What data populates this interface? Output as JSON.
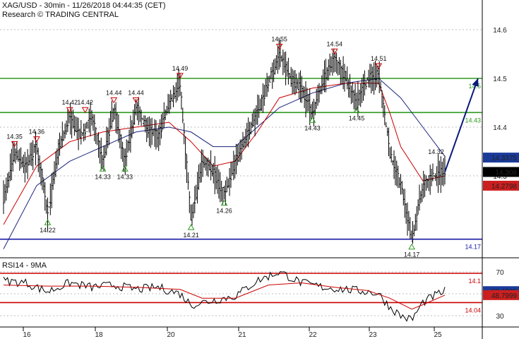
{
  "header": {
    "title": "XAG/USD - 30min - 11/26/2018 04:44:35 (CET)",
    "subtitle": "Research © TRADING CENTRAL"
  },
  "rsi_panel": {
    "label": "RSI14 - 9MA"
  },
  "colors": {
    "price": "#000000",
    "ma_fast": "#cc0000",
    "ma_slow": "#1a237e",
    "resistance": "#2e9a1e",
    "pivot": "#1a1aa6",
    "support": "#cc0000",
    "arrow": "#0a1a7a",
    "badge_blue": "#1a3a9a",
    "badge_red": "#cc1f1f",
    "badge_black": "#000000",
    "grid": "#bdbdbd"
  },
  "chart_data": [
    {
      "type": "line",
      "name": "price",
      "y_ticks": [
        14.3,
        14.4,
        14.5,
        14.6
      ],
      "y_tick_labels": [
        "14.3",
        "14.4",
        "14.5",
        "14.6"
      ],
      "x_tick_labels": [
        "16",
        "18",
        "20",
        "21",
        "22",
        "23",
        "25"
      ],
      "close_path": [
        [
          0,
          14.25
        ],
        [
          1,
          14.35
        ],
        [
          2,
          14.32
        ],
        [
          3,
          14.36
        ],
        [
          4,
          14.22
        ],
        [
          5,
          14.36
        ],
        [
          6,
          14.42
        ],
        [
          7,
          14.38
        ],
        [
          8,
          14.42
        ],
        [
          9,
          14.33
        ],
        [
          10,
          14.44
        ],
        [
          11,
          14.33
        ],
        [
          12,
          14.44
        ],
        [
          13,
          14.4
        ],
        [
          14,
          14.38
        ],
        [
          15,
          14.45
        ],
        [
          16,
          14.49
        ],
        [
          17,
          14.21
        ],
        [
          18,
          14.33
        ],
        [
          19,
          14.31
        ],
        [
          20,
          14.26
        ],
        [
          21,
          14.33
        ],
        [
          22,
          14.38
        ],
        [
          23,
          14.43
        ],
        [
          24,
          14.49
        ],
        [
          25,
          14.55
        ],
        [
          26,
          14.5
        ],
        [
          27,
          14.48
        ],
        [
          28,
          14.43
        ],
        [
          29,
          14.5
        ],
        [
          30,
          14.54
        ],
        [
          31,
          14.5
        ],
        [
          32,
          14.45
        ],
        [
          33,
          14.5
        ],
        [
          34,
          14.51
        ],
        [
          35,
          14.35
        ],
        [
          36,
          14.28
        ],
        [
          37,
          14.17
        ],
        [
          38,
          14.28
        ],
        [
          39,
          14.3
        ],
        [
          40,
          14.308
        ]
      ],
      "moving_average_fast": [
        [
          0,
          14.2
        ],
        [
          3,
          14.32
        ],
        [
          6,
          14.37
        ],
        [
          9,
          14.39
        ],
        [
          12,
          14.4
        ],
        [
          15,
          14.41
        ],
        [
          17,
          14.37
        ],
        [
          19,
          14.32
        ],
        [
          21,
          14.33
        ],
        [
          23,
          14.39
        ],
        [
          25,
          14.46
        ],
        [
          28,
          14.48
        ],
        [
          31,
          14.49
        ],
        [
          34,
          14.49
        ],
        [
          35,
          14.43
        ],
        [
          36,
          14.36
        ],
        [
          38,
          14.29
        ],
        [
          40,
          14.3
        ]
      ],
      "moving_average_slow": [
        [
          0,
          14.15
        ],
        [
          3,
          14.28
        ],
        [
          6,
          14.33
        ],
        [
          9,
          14.36
        ],
        [
          12,
          14.39
        ],
        [
          15,
          14.4
        ],
        [
          17,
          14.39
        ],
        [
          19,
          14.36
        ],
        [
          21,
          14.36
        ],
        [
          23,
          14.4
        ],
        [
          25,
          14.44
        ],
        [
          28,
          14.47
        ],
        [
          31,
          14.49
        ],
        [
          34,
          14.5
        ],
        [
          36,
          14.46
        ],
        [
          38,
          14.4
        ],
        [
          40,
          14.34
        ]
      ],
      "levels": [
        {
          "value": 14.5,
          "label": "14.5",
          "kind": "resistance"
        },
        {
          "value": 14.43,
          "label": "14.43",
          "kind": "resistance"
        },
        {
          "value": 14.17,
          "label": "14.17",
          "kind": "pivot"
        },
        {
          "value": 14.1,
          "label": "14.1",
          "kind": "support"
        },
        {
          "value": 14.04,
          "label": "14.04",
          "kind": "support"
        }
      ],
      "badges": [
        {
          "value": 14.3375,
          "label": "14.3375",
          "color": "blue"
        },
        {
          "value": 14.308,
          "label": "14.308",
          "color": "black"
        },
        {
          "value": 14.2798,
          "label": "14.2798",
          "color": "red"
        }
      ],
      "forecast_arrow": {
        "from": [
          40,
          14.308
        ],
        "to": [
          43,
          14.5
        ]
      },
      "annotations": [
        {
          "label": "14.35",
          "x": 1,
          "value": 14.35,
          "dir": "high"
        },
        {
          "label": "14.36",
          "x": 3,
          "value": 14.36,
          "dir": "high"
        },
        {
          "label": "14.22",
          "x": 4,
          "value": 14.22,
          "dir": "low"
        },
        {
          "label": "14.42",
          "x": 6,
          "value": 14.42,
          "dir": "high"
        },
        {
          "label": "14.42",
          "x": 7.4,
          "value": 14.42,
          "dir": "high"
        },
        {
          "label": "14.33",
          "x": 9,
          "value": 14.33,
          "dir": "low"
        },
        {
          "label": "14.44",
          "x": 10,
          "value": 14.44,
          "dir": "high"
        },
        {
          "label": "14.33",
          "x": 11,
          "value": 14.33,
          "dir": "low"
        },
        {
          "label": "14.44",
          "x": 12,
          "value": 14.44,
          "dir": "high"
        },
        {
          "label": "14.49",
          "x": 16,
          "value": 14.49,
          "dir": "high"
        },
        {
          "label": "14.21",
          "x": 17,
          "value": 14.21,
          "dir": "low"
        },
        {
          "label": "14.26",
          "x": 20,
          "value": 14.26,
          "dir": "low"
        },
        {
          "label": "14.55",
          "x": 25,
          "value": 14.55,
          "dir": "high"
        },
        {
          "label": "14.43",
          "x": 28,
          "value": 14.43,
          "dir": "low"
        },
        {
          "label": "14.54",
          "x": 30,
          "value": 14.54,
          "dir": "high"
        },
        {
          "label": "14.45",
          "x": 32,
          "value": 14.45,
          "dir": "low"
        },
        {
          "label": "14.51",
          "x": 34,
          "value": 14.51,
          "dir": "high"
        },
        {
          "label": "14.17",
          "x": 37,
          "value": 14.17,
          "dir": "low"
        },
        {
          "label": "14.32",
          "x": 39.2,
          "value": 14.345,
          "dir": "text"
        }
      ]
    },
    {
      "type": "line",
      "name": "RSI14 - 9MA",
      "y_ticks": [
        30,
        50,
        70
      ],
      "y_tick_labels": [
        "30",
        "50",
        "70"
      ],
      "rsi": [
        [
          0,
          62
        ],
        [
          2,
          60
        ],
        [
          4,
          52
        ],
        [
          6,
          60
        ],
        [
          8,
          56
        ],
        [
          10,
          58
        ],
        [
          12,
          54
        ],
        [
          14,
          56
        ],
        [
          16,
          50
        ],
        [
          17,
          40
        ],
        [
          19,
          44
        ],
        [
          21,
          48
        ],
        [
          23,
          62
        ],
        [
          24,
          66
        ],
        [
          25,
          70
        ],
        [
          27,
          60
        ],
        [
          29,
          56
        ],
        [
          31,
          54
        ],
        [
          33,
          52
        ],
        [
          34,
          50
        ],
        [
          35,
          38
        ],
        [
          36,
          30
        ],
        [
          37,
          26
        ],
        [
          38,
          42
        ],
        [
          39,
          48
        ],
        [
          40,
          52.4235
        ]
      ],
      "ma": [
        [
          0,
          58
        ],
        [
          4,
          57
        ],
        [
          8,
          57
        ],
        [
          12,
          56
        ],
        [
          16,
          54
        ],
        [
          18,
          46
        ],
        [
          21,
          46
        ],
        [
          24,
          58
        ],
        [
          27,
          60
        ],
        [
          30,
          56
        ],
        [
          33,
          53
        ],
        [
          35,
          46
        ],
        [
          37,
          36
        ],
        [
          38,
          40
        ],
        [
          40,
          48.7999
        ]
      ],
      "badges": [
        {
          "value": 52.4235,
          "label": "52.4235",
          "color": "blue"
        },
        {
          "value": 48.7999,
          "label": "48.7999",
          "color": "red"
        }
      ]
    }
  ]
}
